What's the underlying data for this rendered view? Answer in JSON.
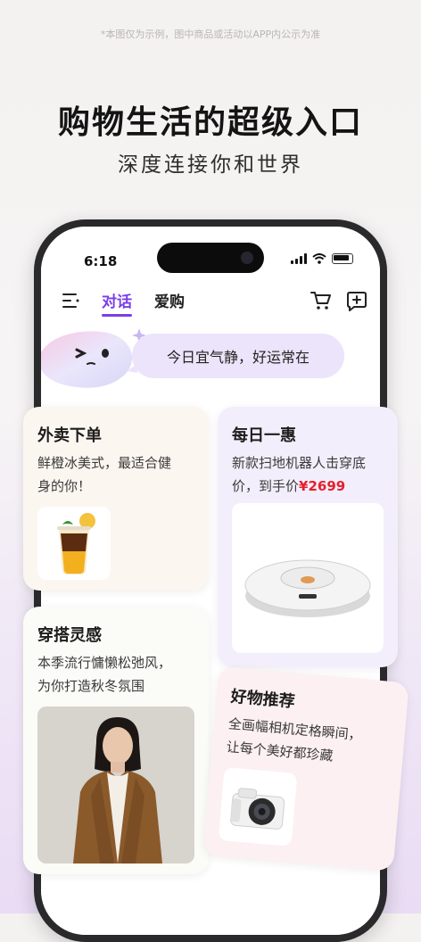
{
  "disclaimer": "*本图仅为示例，图中商品或活动以APP内公示为准",
  "headline": "购物生活的超级入口",
  "subheadline": "深度连接你和世界",
  "status_bar": {
    "time": "6:18"
  },
  "nav": {
    "tabs": [
      {
        "label": "对话",
        "active": true
      },
      {
        "label": "爱购",
        "active": false
      }
    ]
  },
  "greeting": "今日宜气静，好运常在",
  "cards": {
    "takeout": {
      "title": "外卖下单",
      "desc_line1": "鲜橙冰美式，最适合健",
      "desc_line2": "身的你！"
    },
    "daily_deal": {
      "title": "每日一惠",
      "desc_line1": "新款扫地机器人击穿底",
      "desc_prefix": "价，到手价",
      "price": "¥2699"
    },
    "outfit": {
      "title": "穿搭灵感",
      "desc_line1": "本季流行慵懒松弛风，",
      "desc_line2": "为你打造秋冬氛围"
    },
    "recommend": {
      "title": "好物推荐",
      "desc_line1": "全画幅相机定格瞬间，",
      "desc_line2": "让每个美好都珍藏"
    }
  },
  "colors": {
    "accent": "#7a3ee8",
    "price": "#e4202e"
  }
}
